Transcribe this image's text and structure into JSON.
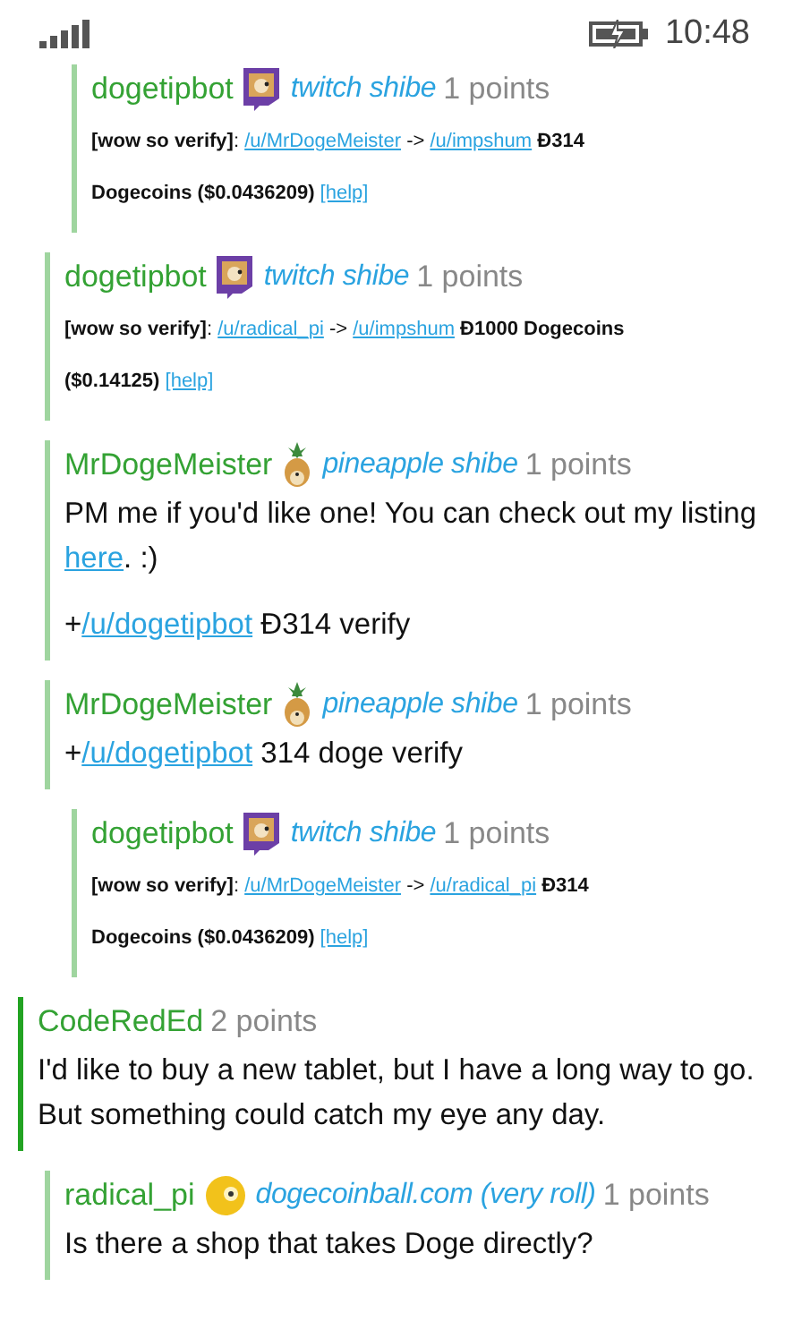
{
  "status_bar": {
    "time": "10:48"
  },
  "comments": [
    {
      "children": [
        {
          "children": [
            {
              "author": "dogetipbot",
              "flair_icon": {
                "kind": "twitch"
              },
              "flair": "twitch shibe",
              "points": "1 points",
              "body": [
                {
                  "kind": "tip",
                  "segments": [
                    {
                      "kind": "bold",
                      "text": "[wow so verify]"
                    },
                    {
                      "kind": "text",
                      "text": ": "
                    },
                    {
                      "kind": "link",
                      "text": "/u/MrDogeMeister"
                    },
                    {
                      "kind": "text",
                      "text": " -> "
                    },
                    {
                      "kind": "link",
                      "text": "/u/impshum"
                    },
                    {
                      "kind": "bold",
                      "text": " Ð314 Dogecoins ($0.0436209) "
                    },
                    {
                      "kind": "link",
                      "text": "[help]"
                    }
                  ]
                }
              ]
            }
          ]
        },
        {
          "author": "dogetipbot",
          "flair_icon": {
            "kind": "twitch"
          },
          "flair": "twitch shibe",
          "points": "1 points",
          "body": [
            {
              "kind": "tip",
              "segments": [
                {
                  "kind": "bold",
                  "text": "[wow so verify]"
                },
                {
                  "kind": "text",
                  "text": ": "
                },
                {
                  "kind": "link",
                  "text": "/u/radical_pi"
                },
                {
                  "kind": "text",
                  "text": " -> "
                },
                {
                  "kind": "link",
                  "text": "/u/impshum"
                },
                {
                  "kind": "bold",
                  "text": " Ð1000 Dogecoins ($0.14125) "
                },
                {
                  "kind": "link",
                  "text": "[help]"
                }
              ]
            }
          ]
        },
        {
          "author": "MrDogeMeister",
          "flair_icon": {
            "kind": "pineapple"
          },
          "flair": "pineapple shibe",
          "points": "1 points",
          "body": [
            {
              "kind": "normal",
              "segments": [
                {
                  "kind": "text",
                  "text": "PM me if you'd like one! You can check out my listing "
                },
                {
                  "kind": "link",
                  "text": "here"
                },
                {
                  "kind": "text",
                  "text": ". :)"
                }
              ]
            },
            {
              "kind": "normal",
              "segments": [
                {
                  "kind": "text",
                  "text": "+"
                },
                {
                  "kind": "link",
                  "text": "/u/dogetipbot"
                },
                {
                  "kind": "text",
                  "text": " Ð314 verify"
                }
              ]
            }
          ]
        },
        {
          "author": "MrDogeMeister",
          "flair_icon": {
            "kind": "pineapple"
          },
          "flair": "pineapple shibe",
          "points": "1 points",
          "body": [
            {
              "kind": "normal",
              "segments": [
                {
                  "kind": "text",
                  "text": "+"
                },
                {
                  "kind": "link",
                  "text": "/u/dogetipbot"
                },
                {
                  "kind": "text",
                  "text": " 314 doge verify"
                }
              ]
            }
          ],
          "children": [
            {
              "author": "dogetipbot",
              "flair_icon": {
                "kind": "twitch"
              },
              "flair": "twitch shibe",
              "points": "1 points",
              "body": [
                {
                  "kind": "tip",
                  "segments": [
                    {
                      "kind": "bold",
                      "text": "[wow so verify]"
                    },
                    {
                      "kind": "text",
                      "text": ": "
                    },
                    {
                      "kind": "link",
                      "text": "/u/MrDogeMeister"
                    },
                    {
                      "kind": "text",
                      "text": " -> "
                    },
                    {
                      "kind": "link",
                      "text": "/u/radical_pi"
                    },
                    {
                      "kind": "bold",
                      "text": " Ð314 Dogecoins ($0.0436209) "
                    },
                    {
                      "kind": "link",
                      "text": "[help]"
                    }
                  ]
                }
              ]
            }
          ]
        }
      ]
    },
    {
      "author": "CodeRedEd",
      "points": "2 points",
      "body": [
        {
          "kind": "normal",
          "segments": [
            {
              "kind": "text",
              "text": "I'd like to buy a new tablet, but I have a long way to go. But something could catch my eye any day."
            }
          ]
        }
      ],
      "children": [
        {
          "author": "radical_pi",
          "flair_icon": {
            "kind": "ball"
          },
          "flair": "dogecoinball.com (very roll)",
          "points": "1 points",
          "body": [
            {
              "kind": "normal",
              "segments": [
                {
                  "kind": "text",
                  "text": "Is there a shop that takes Doge directly?"
                }
              ]
            }
          ]
        }
      ]
    }
  ]
}
